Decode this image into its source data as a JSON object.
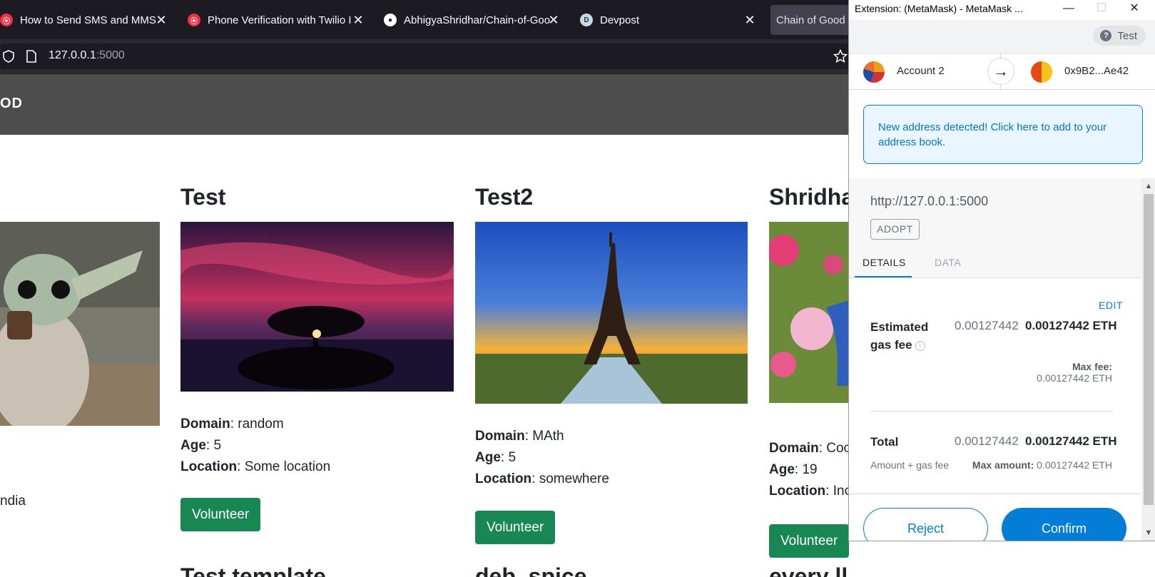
{
  "browser": {
    "tabs": [
      {
        "title": "How to Send SMS and MMS M",
        "icon": "twilio-icon"
      },
      {
        "title": "Phone Verification with Twilio I",
        "icon": "twilio-icon"
      },
      {
        "title": "AbhigyaShridhar/Chain-of-Goo",
        "icon": "github-icon"
      },
      {
        "title": "Devpost",
        "icon": "devpost-icon"
      },
      {
        "title": "Chain of Good",
        "icon": "none"
      }
    ],
    "url_host": "127.0.0.1",
    "url_port": ":5000"
  },
  "site": {
    "brand": "OD",
    "cards": [
      {
        "title": "",
        "domain": "",
        "age": "",
        "location": "ndia",
        "button": ""
      },
      {
        "title": "Test",
        "domain_label": "Domain",
        "domain": ": random",
        "age_label": "Age",
        "age": ": 5",
        "location_label": "Location",
        "location": ": Some location",
        "button": "Volunteer"
      },
      {
        "title": "Test2",
        "domain_label": "Domain",
        "domain": ": MAth",
        "age_label": "Age",
        "age": ": 5",
        "location_label": "Location",
        "location": ": somewhere",
        "button": "Volunteer"
      },
      {
        "title": "Shridha",
        "domain_label": "Domain",
        "domain": ": Coc",
        "age_label": "Age",
        "age": ": 19",
        "location_label": "Location",
        "location": ": Inc",
        "button": "Volunteer"
      }
    ],
    "next_row_titles": [
      "Test template",
      "deb. spice",
      "every ll"
    ]
  },
  "metamask": {
    "window_title": "Extension: (MetaMask) - MetaMask ...",
    "window_controls": {
      "minimize": "—",
      "maximize": "☐",
      "close": "✕"
    },
    "network": "Test",
    "from_account": "Account 2",
    "to_address": "0x9B2...Ae42",
    "alert": "New address detected! Click here to add to your address book.",
    "origin": "http://127.0.0.1:5000",
    "method": "ADOPT",
    "tabs": {
      "details": "DETAILS",
      "data": "DATA"
    },
    "edit": "EDIT",
    "gas_fee": {
      "label": "Estimated gas fee",
      "secondary": "0.00127442",
      "primary": "0.00127442 ETH",
      "max_fee_label": "Max fee:",
      "max_fee_value": "0.00127442 ETH"
    },
    "total": {
      "label": "Total",
      "secondary": "0.00127442",
      "primary": "0.00127442 ETH",
      "sub_label": "Amount + gas fee",
      "max_amount_label": "Max amount:",
      "max_amount_value": "0.00127442 ETH"
    },
    "buttons": {
      "reject": "Reject",
      "confirm": "Confirm"
    }
  },
  "colors": {
    "volunteer_button": "#198754",
    "metamask_blue": "#037dd6",
    "header_bg": "#4d4d4d"
  }
}
